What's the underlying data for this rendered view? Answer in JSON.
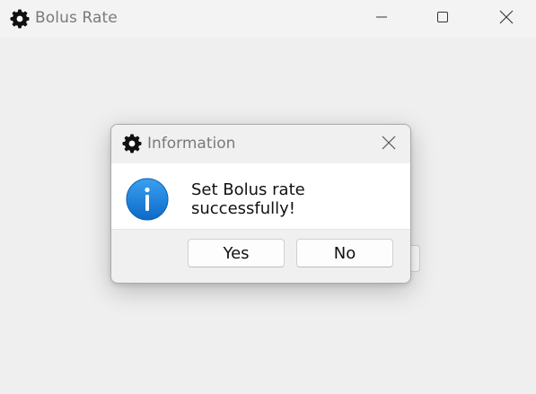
{
  "window": {
    "title": "Bolus Rate",
    "controls": {
      "minimize": "minimize-icon",
      "maximize": "maximize-icon",
      "close": "close-icon"
    }
  },
  "dialog": {
    "title": "Information",
    "icon": "info-icon",
    "message": "Set Bolus rate successfully!",
    "buttons": {
      "yes_label": "Yes",
      "no_label": "No"
    }
  },
  "colors": {
    "info_blue": "#1a7fd9",
    "title_text": "#7a7a7a"
  }
}
